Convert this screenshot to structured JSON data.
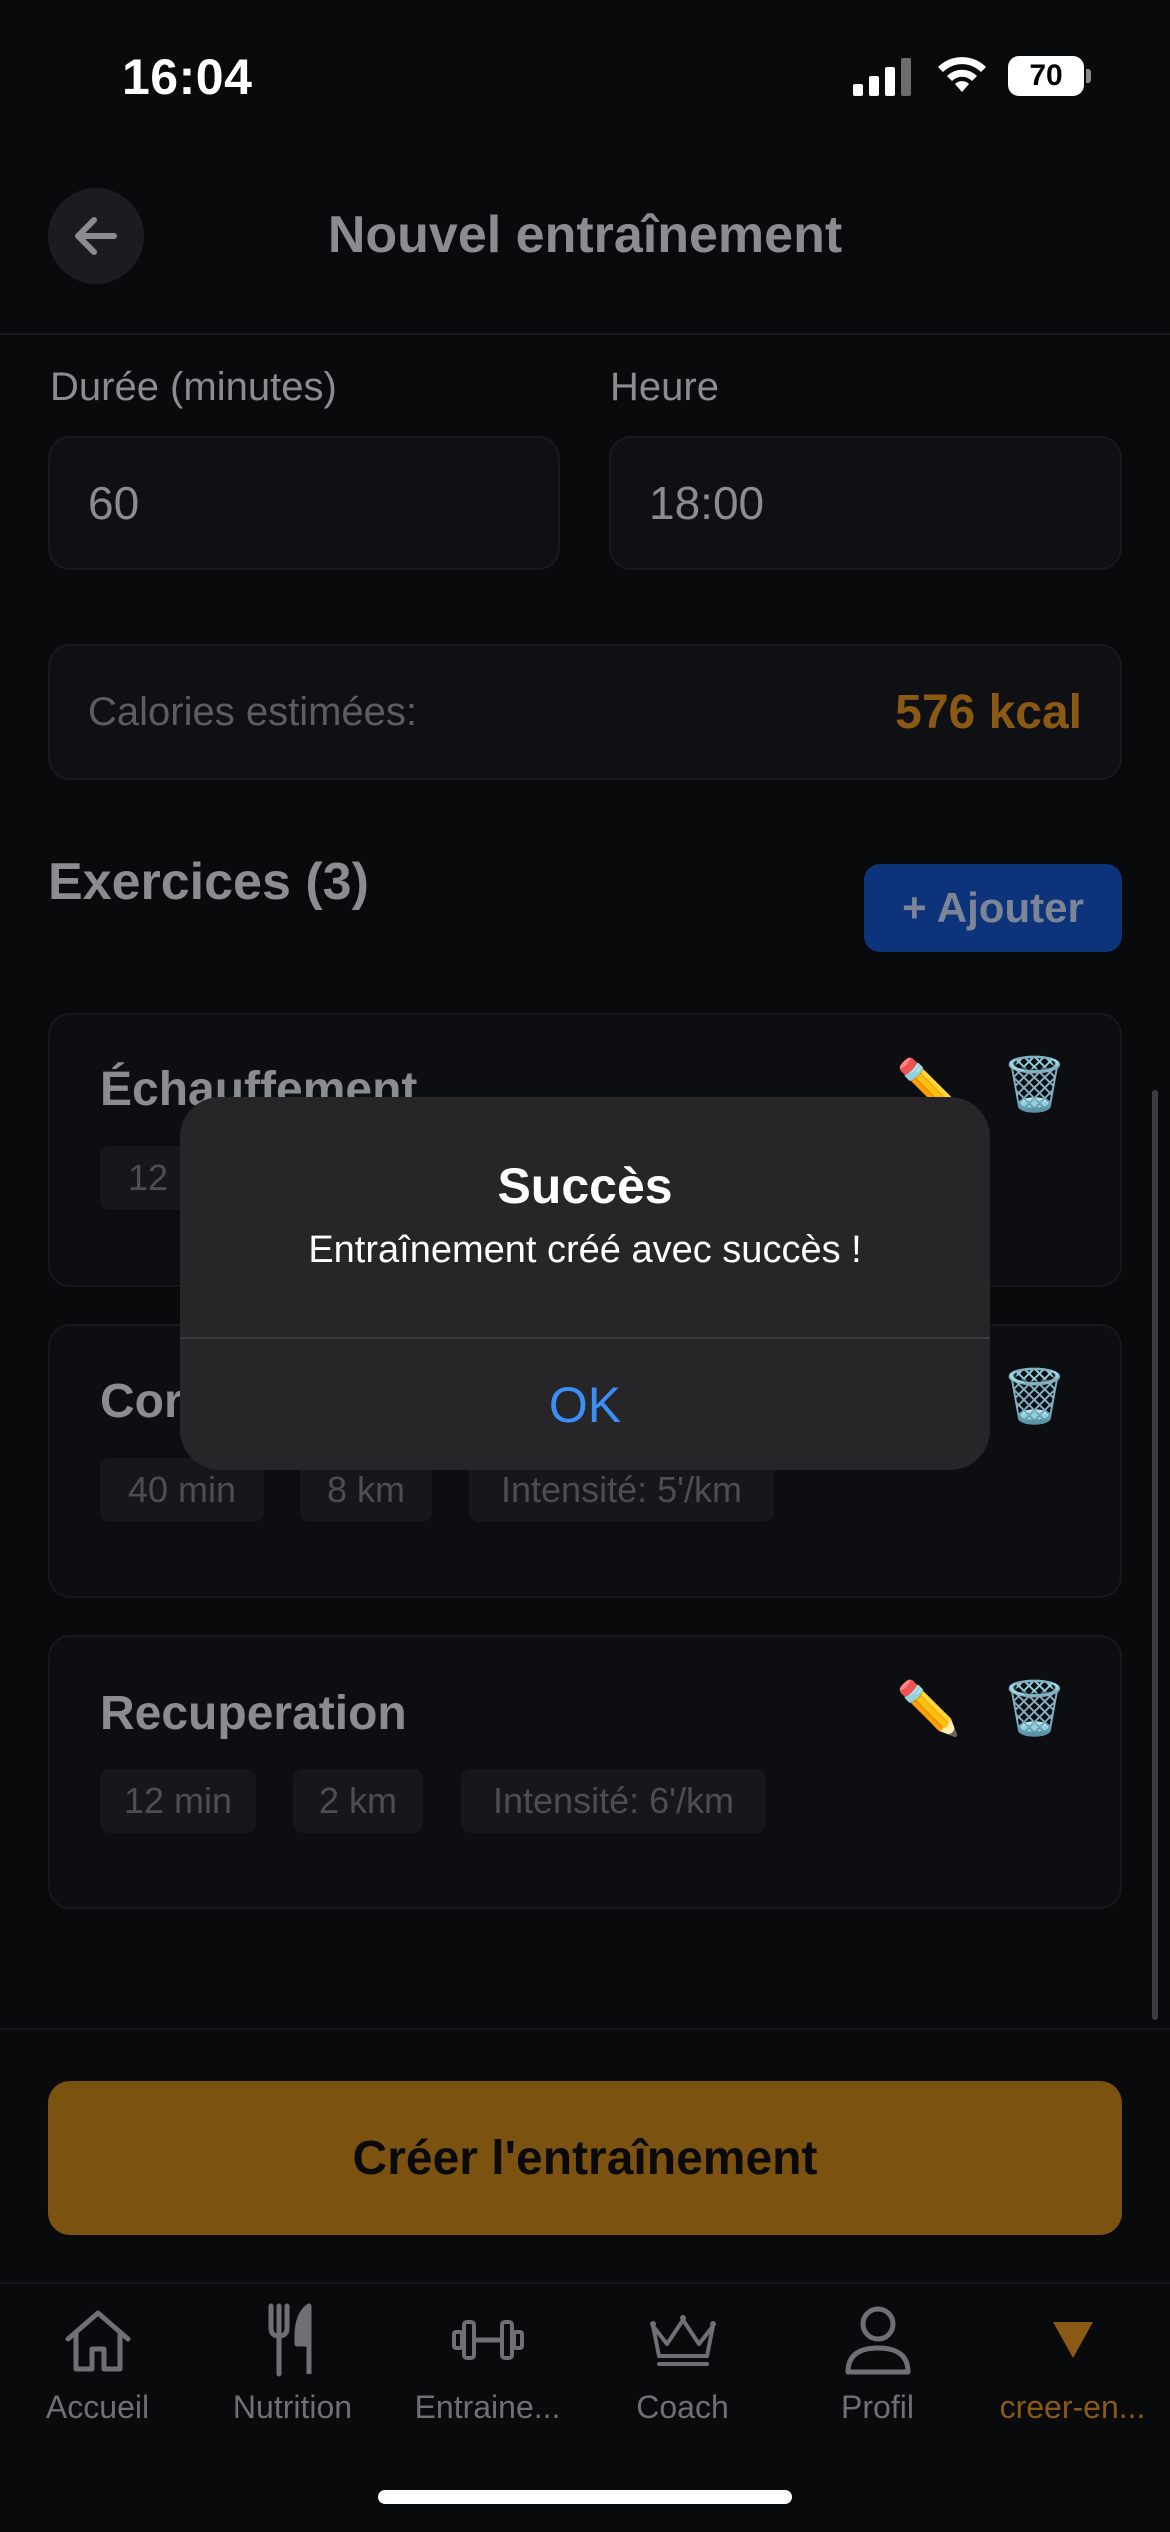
{
  "status_bar": {
    "time": "16:04",
    "battery": "70"
  },
  "header": {
    "title": "Nouvel entraînement"
  },
  "form": {
    "duration_label": "Durée (minutes)",
    "duration_value": "60",
    "time_label": "Heure",
    "time_value": "18:00",
    "calories_label": "Calories estimées:",
    "calories_value": "576 kcal"
  },
  "exercises": {
    "title": "Exercices (3)",
    "add_label": "+ Ajouter",
    "items": [
      {
        "name": "Échauffement",
        "chips": [
          "12 min"
        ]
      },
      {
        "name": "Cor",
        "chips": [
          "40 min",
          "8 km",
          "Intensité: 5'/km"
        ]
      },
      {
        "name": "Recuperation",
        "chips": [
          "12 min",
          "2 km",
          "Intensité: 6'/km"
        ]
      }
    ]
  },
  "create_button": "Créer l'entraînement",
  "tabs": [
    {
      "label": "Accueil",
      "icon": "home-icon"
    },
    {
      "label": "Nutrition",
      "icon": "fork-knife-icon"
    },
    {
      "label": "Entraine...",
      "icon": "dumbbell-icon"
    },
    {
      "label": "Coach",
      "icon": "crown-icon"
    },
    {
      "label": "Profil",
      "icon": "person-icon"
    },
    {
      "label": "creer-en...",
      "icon": "triangle-down-icon",
      "active": true
    }
  ],
  "dialog": {
    "title": "Succès",
    "message": "Entraînement créé avec succès !",
    "ok_label": "OK"
  },
  "colors": {
    "accent": "#7c5211",
    "active_tab": "#a8720f",
    "link": "#3a8ef6",
    "add_button": "#0d347a"
  }
}
